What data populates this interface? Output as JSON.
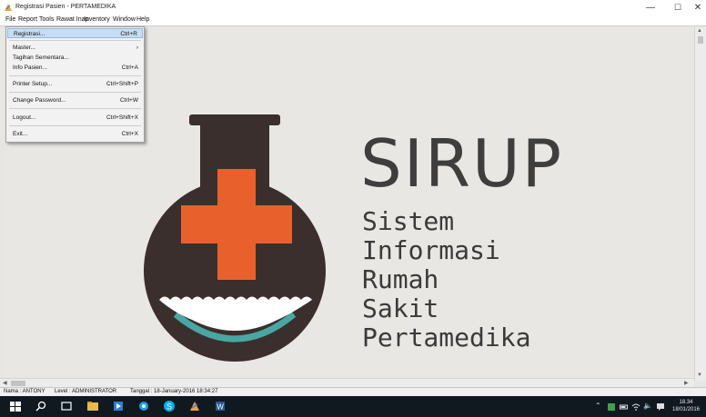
{
  "window": {
    "title": "Registrasi Pasien - PERTAMEDIKA",
    "minimize": "—",
    "maximize": "☐",
    "close": "✕"
  },
  "menubar": [
    "File",
    "Report",
    "Tools",
    "Rawat Inap",
    "Inventory",
    "Window",
    "Help"
  ],
  "file_menu": {
    "items": [
      {
        "label": "Registrasi...",
        "shortcut": "Ctrl+R"
      },
      {
        "label": "Master...",
        "shortcut": "›"
      },
      {
        "label": "Tagihan Sementara...",
        "shortcut": ""
      },
      {
        "label": "Info Pasien...",
        "shortcut": "Ctrl+A"
      },
      {
        "label": "Printer Setup...",
        "shortcut": "Ctrl+Shift+P"
      },
      {
        "label": "Change Password...",
        "shortcut": "Ctrl+W"
      },
      {
        "label": "Logout...",
        "shortcut": "Ctrl+Shift+X"
      },
      {
        "label": "Exit...",
        "shortcut": "Ctrl+X"
      }
    ]
  },
  "logo": {
    "title": "SIRUP",
    "lines": [
      "Sistem",
      "Informasi",
      "Rumah",
      "Sakit",
      "Pertamedika"
    ],
    "colors": {
      "flask": "#3a2f2c",
      "cross": "#e8612c",
      "wave": "#ffffff",
      "teal": "#4aa6a3"
    }
  },
  "statusbar": {
    "name": "Nama : ANTONY",
    "level": "Level : ADMINISTRATOR",
    "date": "Tanggal : 18-January-2016  18:34:27"
  },
  "taskbar": {
    "time": "18.34",
    "date": "18/01/2016"
  }
}
